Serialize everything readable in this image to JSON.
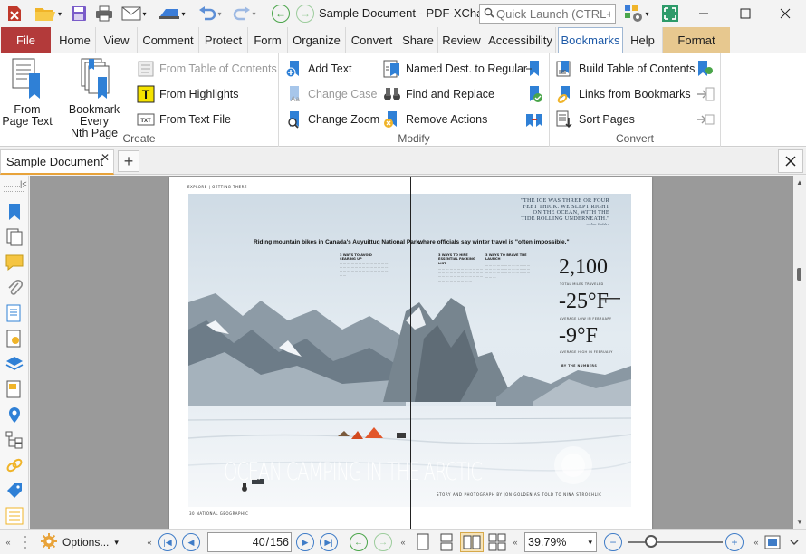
{
  "titlebar": {
    "document_title": "Sample Document - PDF-XCha...",
    "quick_launch_placeholder": "Quick Launch (CTRL+.)"
  },
  "menu": {
    "tabs": [
      "File",
      "Home",
      "View",
      "Comment",
      "Protect",
      "Form",
      "Organize",
      "Convert",
      "Share",
      "Review",
      "Accessibility",
      "Bookmarks",
      "Help",
      "Format"
    ],
    "active": "Bookmarks"
  },
  "ribbon": {
    "create": {
      "label": "Create",
      "from_page_text": [
        "From",
        "Page Text"
      ],
      "bookmark_every": [
        "Bookmark Every",
        "Nth Page"
      ],
      "from_toc": "From Table of Contents",
      "from_highlights": "From Highlights",
      "from_text_file": "From Text File"
    },
    "modify": {
      "label": "Modify",
      "add_text": "Add Text",
      "change_case": "Change Case",
      "change_zoom": "Change Zoom",
      "named_dest": "Named Dest. to Regular",
      "find_replace": "Find and Replace",
      "remove_actions": "Remove Actions"
    },
    "convert": {
      "label": "Convert",
      "build_toc": "Build Table of Contents",
      "links_from_bookmarks": "Links from Bookmarks",
      "sort_pages": "Sort Pages"
    }
  },
  "doc_tab": {
    "label": "Sample Document"
  },
  "magazine": {
    "section": "EXPLORE  |  GETTING THERE",
    "headline_left": "Riding mountain bikes in Canada's Auyuittuq National Park,",
    "headline_right": "where officials say winter travel is \"often impossible.\"",
    "quote": [
      "\"THE ICE WAS THREE OR FOUR",
      "FEET THICK. WE SLEPT RIGHT",
      "ON THE OCEAN, WITH THE",
      "TIDE ROLLING UNDERNEATH.\""
    ],
    "quote_attr": "— Jon Golden",
    "stat1": "2,100",
    "stat1_cap": "TOTAL MILES TRAVELED",
    "stat2": "-25°F",
    "stat2_cap": "AVERAGE LOW IN FEBRUARY",
    "stat3": "-9°F",
    "stat3_cap": "AVERAGE HIGH IN FEBRUARY",
    "by_numbers": "BY THE NUMBERS",
    "col1_head": "3 WAYS TO AVOID SEARING UP",
    "col2_head": "3 WAYS TO HIRE ESSENTIAL PACKING LIST",
    "col3_head": "3 WAYS TO BRAVE THE LAUNCH",
    "overlay_title": "OCEAN CAMPING IN THE ARCTIC",
    "credit": "STORY AND PHOTOGRAPH BY JON GOLDEN AS TOLD TO NINA STROCHLIC",
    "footer_left": "30  NATIONAL GEOGRAPHIC"
  },
  "bottom": {
    "options_label": "Options...",
    "page_current": "40",
    "page_total": "156",
    "zoom": "39.79%"
  }
}
